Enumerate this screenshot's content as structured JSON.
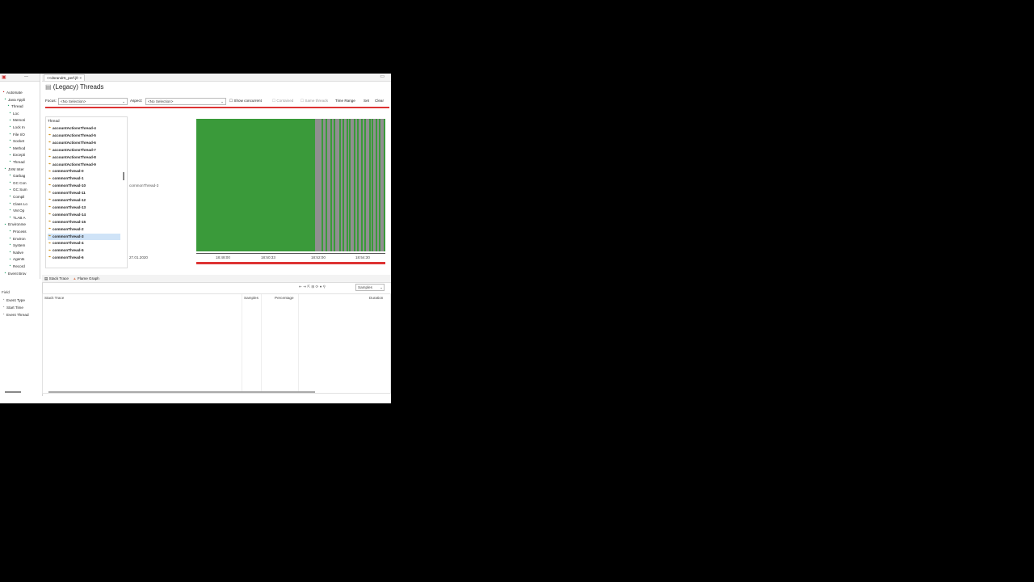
{
  "editor": {
    "tab_label": "<<dsrandr5_perf.jfr",
    "title": "(Legacy) Threads"
  },
  "nav": {
    "items": [
      {
        "label": "Automate",
        "icon": "red-square-icon"
      },
      {
        "label": "Java Appli",
        "icon": "java-icon"
      },
      {
        "label": "Thread",
        "icon": "thread-icon"
      },
      {
        "label": "Loc",
        "icon": "lock-icon"
      },
      {
        "label": "Memori",
        "icon": "memory-icon"
      },
      {
        "label": "Lock In",
        "icon": "lock-icon"
      },
      {
        "label": "File I/O",
        "icon": "file-icon"
      },
      {
        "label": "Socket",
        "icon": "socket-icon"
      },
      {
        "label": "Method",
        "icon": "method-icon"
      },
      {
        "label": "Excepti",
        "icon": "exception-icon"
      },
      {
        "label": "Thread",
        "icon": "thread-icon"
      },
      {
        "label": "JVM Inter",
        "icon": "jvm-icon"
      },
      {
        "label": "Garbag",
        "icon": "gc-icon"
      },
      {
        "label": "GC Con",
        "icon": "gc-icon"
      },
      {
        "label": "GC Sum",
        "icon": "gc-icon"
      },
      {
        "label": "Compil",
        "icon": "compile-icon"
      },
      {
        "label": "Class Lo",
        "icon": "class-icon"
      },
      {
        "label": "VM Op",
        "icon": "vm-icon"
      },
      {
        "label": "TLAB A",
        "icon": "tlab-icon"
      },
      {
        "label": "Environme",
        "icon": "env-icon"
      },
      {
        "label": "Process",
        "icon": "process-icon"
      },
      {
        "label": "Environ",
        "icon": "env-icon"
      },
      {
        "label": "System",
        "icon": "system-icon"
      },
      {
        "label": "Native",
        "icon": "native-icon"
      },
      {
        "label": "Agents",
        "icon": "agent-icon"
      },
      {
        "label": "Record",
        "icon": "record-icon"
      },
      {
        "label": "Event Brov",
        "icon": "event-icon"
      }
    ]
  },
  "filter": {
    "focus_label": "Focus:",
    "focus_value": "<No Selection>",
    "aspect_label": "Aspect:",
    "aspect_value": "<No Selection>",
    "show_concurrent": "Show concurrent",
    "contained": "Contained",
    "same_threads": "Same threads",
    "time_range": "Time Range",
    "set": "Set",
    "clear": "Clear"
  },
  "threads": {
    "header": "Thread",
    "rows": [
      "accountActionsThread-4",
      "accountActionsThread-5",
      "accountActionsThread-6",
      "accountActionsThread-7",
      "accountActionsThread-8",
      "accountActionsThread-9",
      "commonThread-0",
      "commonThread-1",
      "commonThread-10",
      "commonThread-11",
      "commonThread-12",
      "commonThread-13",
      "commonThread-14",
      "commonThread-15",
      "commonThread-2",
      "commonThread-3",
      "commonThread-4",
      "commonThread-5",
      "commonThread-6"
    ],
    "selected_index": 15
  },
  "chart": {
    "lane_label": "commonThread-3",
    "date_label": "27.01.2020",
    "ticks": [
      "18:48:00",
      "18:50:33",
      "18:52:00",
      "18:54:30"
    ],
    "colors": {
      "running": "#3a9a3a",
      "idle": "#8f8f8f",
      "range": "#d33333"
    }
  },
  "lower": {
    "tab_stack": "Stack Trace",
    "tab_flame": "Flame Graph",
    "samples_dropdown": "Samples",
    "columns": [
      "Stack Trace",
      "Samples",
      "Percentage",
      "Duration"
    ]
  },
  "fields": {
    "header": "Field",
    "rows": [
      "Event Type",
      "Start Time",
      "Event Thread"
    ]
  }
}
